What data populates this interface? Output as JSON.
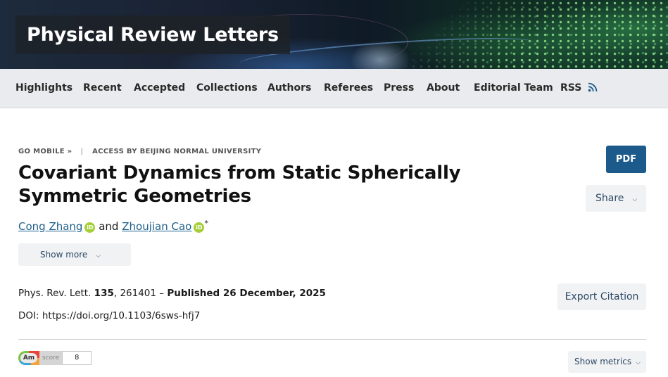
{
  "header": {
    "journal_title": "Physical Review Letters"
  },
  "nav": {
    "items": [
      {
        "label": "Highlights"
      },
      {
        "label": "Recent"
      },
      {
        "label": "Accepted"
      },
      {
        "label": "Collections"
      },
      {
        "label": "Authors"
      },
      {
        "label": "Referees"
      },
      {
        "label": "Press"
      },
      {
        "label": "About"
      },
      {
        "label": "Editorial Team"
      },
      {
        "label": "RSS",
        "icon": "rss-icon"
      }
    ]
  },
  "article": {
    "go_mobile": "GO MOBILE »",
    "separator": "|",
    "access": "ACCESS BY BEIJING NORMAL UNIVERSITY",
    "title": "Covariant Dynamics from Static Spherically Symmetric Geometries",
    "authors": [
      {
        "name": "Cong Zhang",
        "icon": "orcid-icon"
      },
      {
        "name": "Zhoujian Cao",
        "icon": "orcid-icon",
        "mark": "*"
      }
    ],
    "author_joiner": "and",
    "show_more": "Show more",
    "citation": {
      "journal": "Phys. Rev. Lett.",
      "volume": "135",
      "article_number": ", 261401 –",
      "published": "Published 26 December, 2025"
    },
    "doi": "DOI: https://doi.org/10.1103/6sws-hfj7"
  },
  "actions": {
    "pdf": "PDF",
    "share": "Share",
    "export_citation": "Export Citation",
    "show_metrics": "Show metrics"
  },
  "altmetric": {
    "badge_label": "Am",
    "score_label": "score",
    "score": "8"
  },
  "colors": {
    "primary": "#1b5a8a",
    "link": "#1f5f8b",
    "nav_bg": "#e9ebee",
    "button_bg": "#f1f2f4",
    "orcid": "#a6ce39"
  }
}
